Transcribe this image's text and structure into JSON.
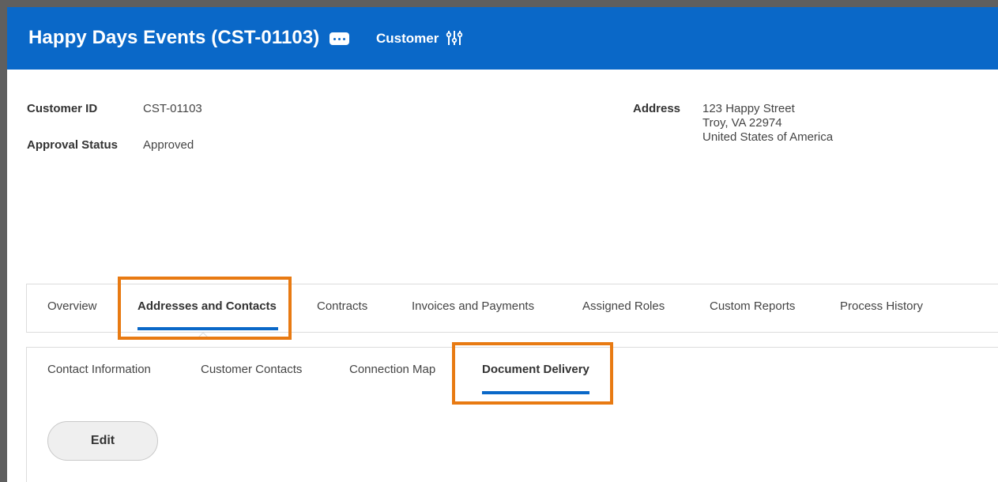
{
  "header": {
    "title": "Happy Days Events (CST-01103)",
    "object_type": "Customer",
    "icons": [
      "more-actions-icon",
      "related-actions-icon"
    ],
    "bg_color": "#0a68c8"
  },
  "fields": {
    "customer_id_label": "Customer ID",
    "customer_id_value": "CST-01103",
    "approval_status_label": "Approval Status",
    "approval_status_value": "Approved",
    "address_label": "Address",
    "address_lines": [
      "123 Happy Street",
      "Troy, VA 22974",
      "United States of America"
    ]
  },
  "main_tabs": [
    {
      "label": "Overview",
      "active": false
    },
    {
      "label": "Addresses and Contacts",
      "active": true
    },
    {
      "label": "Contracts",
      "active": false
    },
    {
      "label": "Invoices and Payments",
      "active": false
    },
    {
      "label": "Assigned Roles",
      "active": false
    },
    {
      "label": "Custom Reports",
      "active": false
    },
    {
      "label": "Process History",
      "active": false
    }
  ],
  "sub_tabs": [
    {
      "label": "Contact Information",
      "active": false
    },
    {
      "label": "Customer Contacts",
      "active": false
    },
    {
      "label": "Connection Map",
      "active": false
    },
    {
      "label": "Document Delivery",
      "active": true
    }
  ],
  "actions": {
    "edit_label": "Edit"
  },
  "colors": {
    "accent": "#0a68c8",
    "highlight": "#e87a12"
  }
}
